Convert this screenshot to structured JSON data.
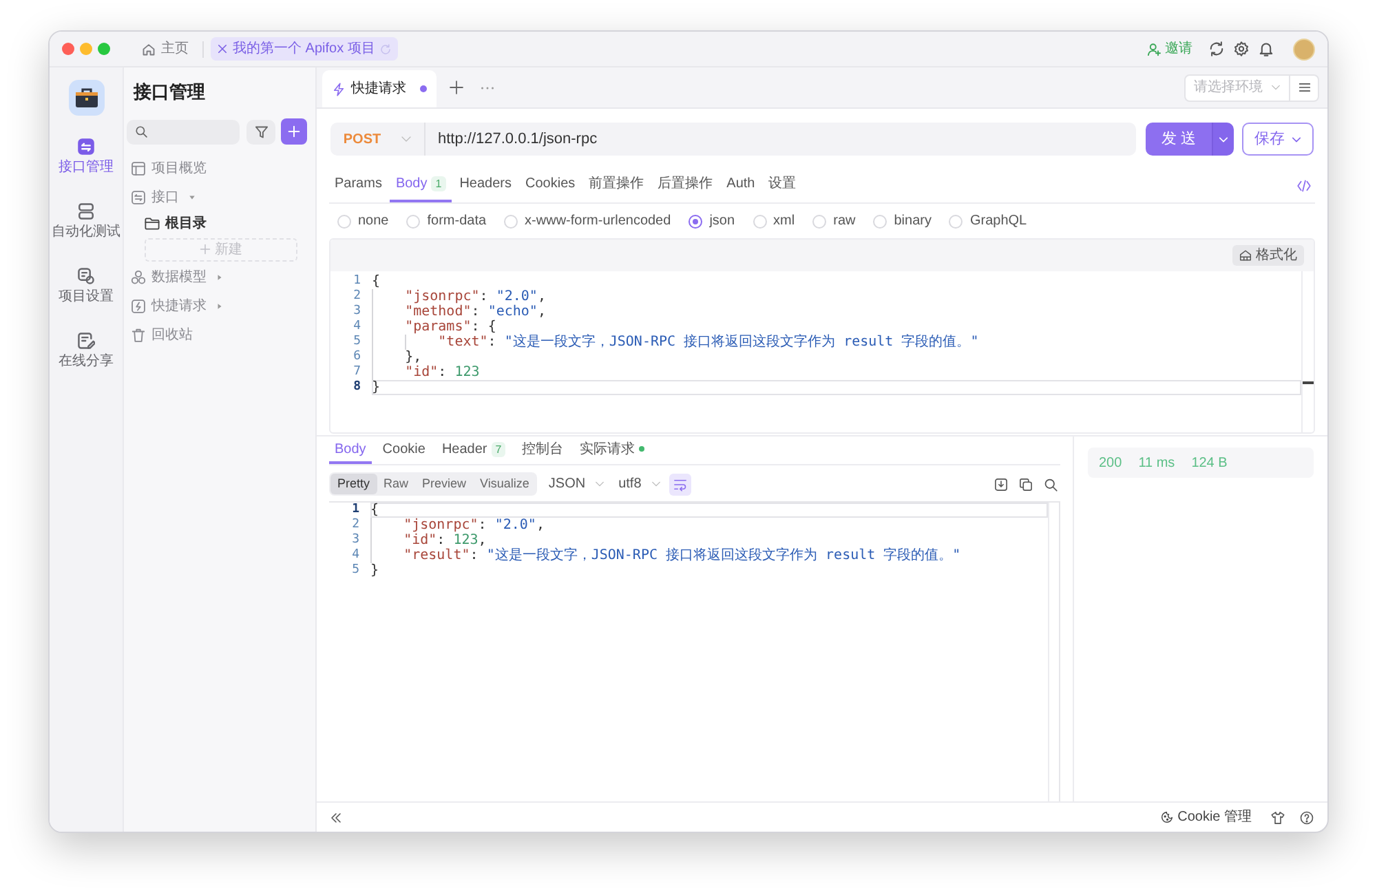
{
  "title_bar": {
    "tabs": [
      {
        "kind": "home",
        "label": "主页",
        "selected": false
      },
      {
        "kind": "project",
        "label": "我的第一个 Apifox 项目",
        "selected": true
      }
    ],
    "invite": "邀请"
  },
  "nav_rail": {
    "items": [
      {
        "kind": "api",
        "label": "接口管理",
        "selected": true
      },
      {
        "kind": "automation",
        "label": "自动化测试",
        "selected": false
      },
      {
        "kind": "settings",
        "label": "项目设置",
        "selected": false
      },
      {
        "kind": "share",
        "label": "在线分享",
        "selected": false
      }
    ]
  },
  "tree_panel": {
    "title": "接口管理",
    "items": [
      {
        "kind": "overview",
        "label": "项目概览"
      },
      {
        "kind": "api",
        "label": "接口",
        "expanded": true,
        "children": [
          {
            "kind": "folder",
            "label": "根目录"
          },
          {
            "kind": "new",
            "label": "新建"
          }
        ]
      },
      {
        "kind": "model",
        "label": "数据模型",
        "expanded": false
      },
      {
        "kind": "quick",
        "label": "快捷请求",
        "expanded": false
      },
      {
        "kind": "trash",
        "label": "回收站"
      }
    ]
  },
  "request_tabs": [
    {
      "label": "快捷请求",
      "selected": true,
      "modified": true
    }
  ],
  "environment": {
    "placeholder": "请选择环境"
  },
  "request": {
    "method": "POST",
    "url": "http://127.0.0.1/json-rpc",
    "send_button": "发 送",
    "save_button": "保存"
  },
  "param_tabs": [
    {
      "label": "Params",
      "selected": false
    },
    {
      "label": "Body",
      "count": "1",
      "selected": true
    },
    {
      "label": "Headers",
      "selected": false
    },
    {
      "label": "Cookies",
      "selected": false
    },
    {
      "label": "前置操作",
      "selected": false
    },
    {
      "label": "后置操作",
      "selected": false
    },
    {
      "label": "Auth",
      "selected": false
    },
    {
      "label": "设置",
      "selected": false
    }
  ],
  "body_types": [
    {
      "label": "none",
      "selected": false
    },
    {
      "label": "form-data",
      "selected": false
    },
    {
      "label": "x-www-form-urlencoded",
      "selected": false
    },
    {
      "label": "json",
      "selected": true
    },
    {
      "label": "xml",
      "selected": false
    },
    {
      "label": "raw",
      "selected": false
    },
    {
      "label": "binary",
      "selected": false
    },
    {
      "label": "GraphQL",
      "selected": false
    }
  ],
  "body_editor": {
    "format_button": "格式化",
    "lines": [
      {
        "number": "1",
        "text": "{",
        "active": false
      },
      {
        "number": "2",
        "text": "    \"jsonrpc\": \"2.0\",",
        "active": false
      },
      {
        "number": "3",
        "text": "    \"method\": \"echo\",",
        "active": false
      },
      {
        "number": "4",
        "text": "    \"params\": {",
        "active": false
      },
      {
        "number": "5",
        "text": "        \"text\": \"这是一段文字，JSON-RPC 接口将返回这段文字作为 result 字段的值。\"",
        "active": false
      },
      {
        "number": "6",
        "text": "    },",
        "active": false
      },
      {
        "number": "7",
        "text": "    \"id\": 123",
        "active": false
      },
      {
        "number": "8",
        "text": "}",
        "active": true
      }
    ]
  },
  "response": {
    "tabs": [
      {
        "label": "Body",
        "selected": true,
        "dot": false
      },
      {
        "label": "Cookie",
        "selected": false,
        "dot": false
      },
      {
        "label": "Header",
        "count": "7",
        "selected": false,
        "dot": false
      },
      {
        "label": "控制台",
        "selected": false,
        "dot": false
      },
      {
        "label": "实际请求",
        "selected": false,
        "dot": true
      }
    ],
    "view_modes": [
      {
        "label": "Pretty",
        "selected": true
      },
      {
        "label": "Raw",
        "selected": false
      },
      {
        "label": "Preview",
        "selected": false
      },
      {
        "label": "Visualize",
        "selected": false
      }
    ],
    "format": "JSON",
    "encoding": "utf8",
    "wrap": true,
    "lines": [
      {
        "number": "1",
        "text": "{",
        "active": true
      },
      {
        "number": "2",
        "text": "    \"jsonrpc\": \"2.0\",",
        "active": false
      },
      {
        "number": "3",
        "text": "    \"id\": 123,",
        "active": false
      },
      {
        "number": "4",
        "text": "    \"result\": \"这是一段文字，JSON-RPC 接口将返回这段文字作为 result 字段的值。\"",
        "active": false
      },
      {
        "number": "5",
        "text": "}",
        "active": false
      }
    ],
    "status": {
      "code": "200",
      "time": "11 ms",
      "size": "124 B"
    }
  },
  "bottom_bar": {
    "cookie_manager": "Cookie 管理"
  }
}
